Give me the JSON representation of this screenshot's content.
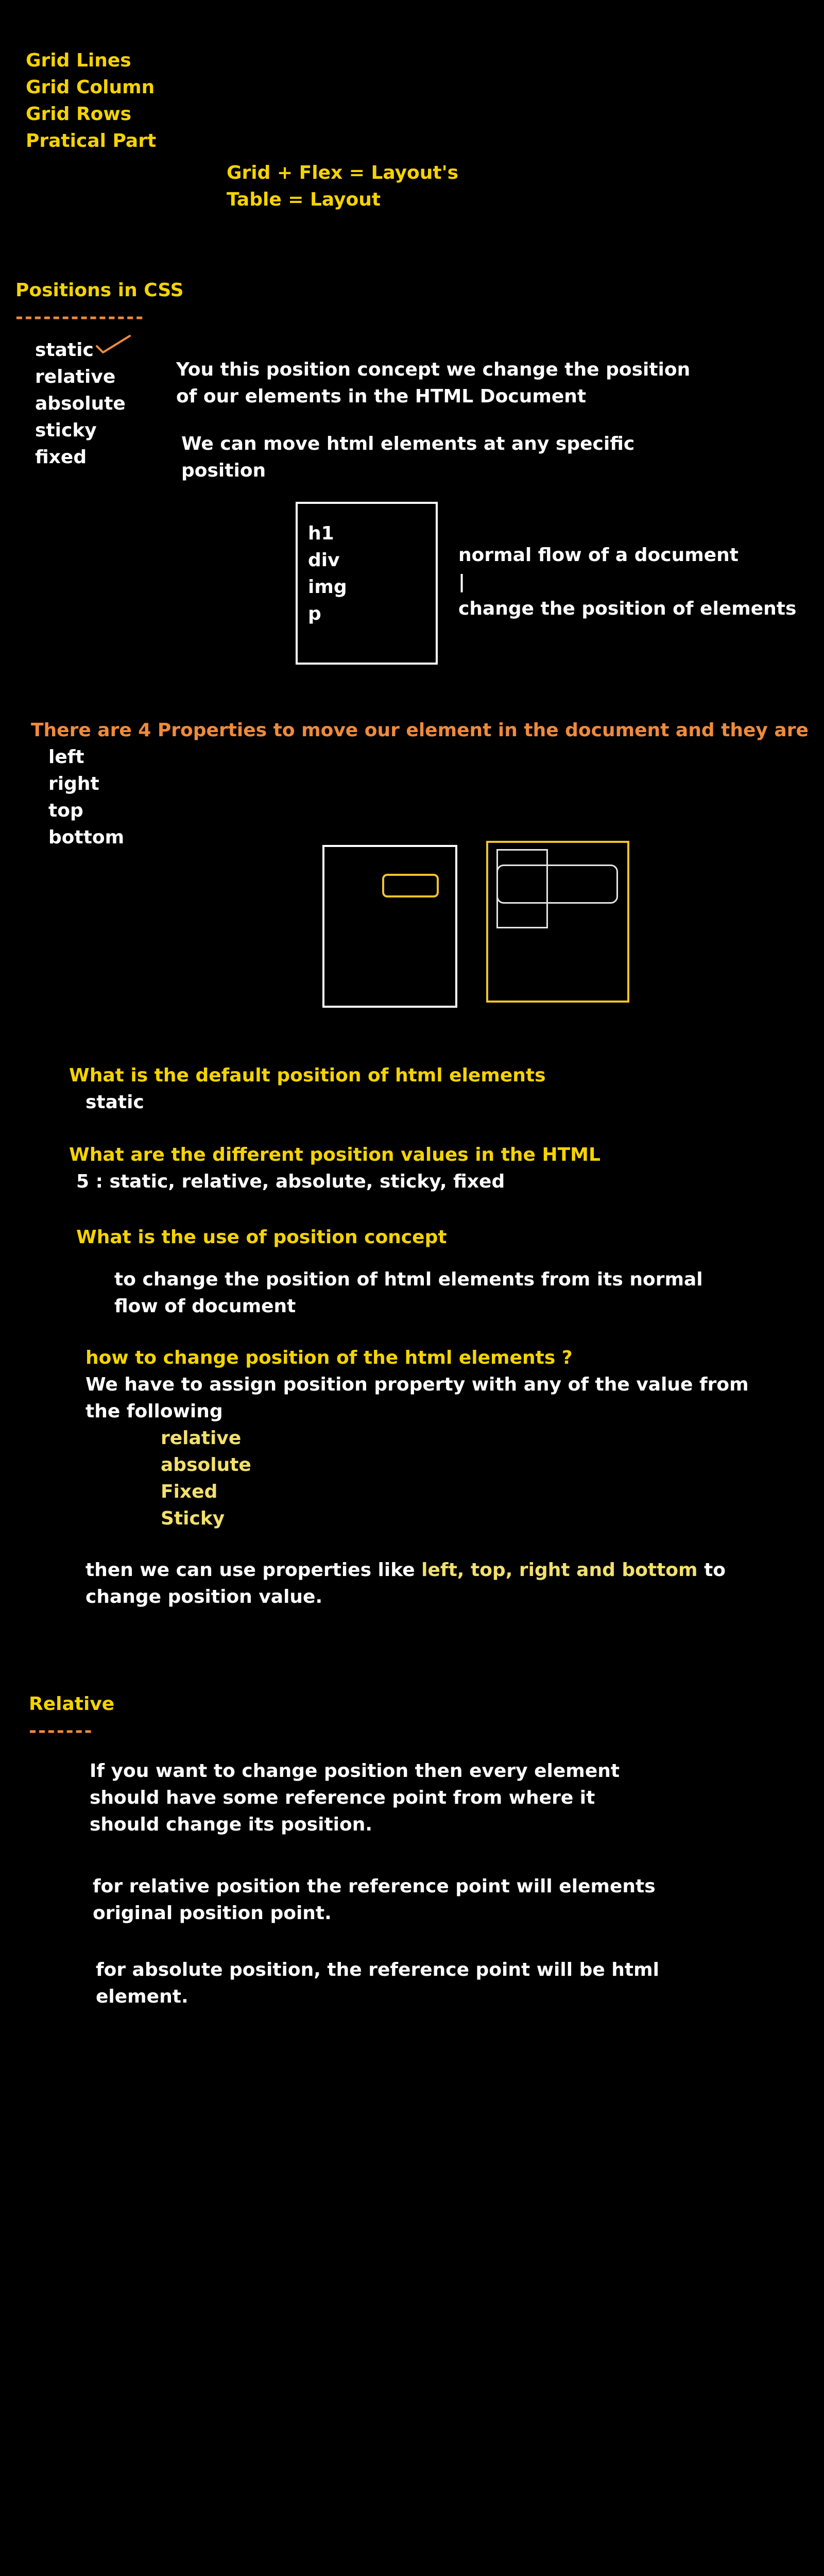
{
  "grid_topics": [
    "Grid Lines",
    "Grid Column",
    "Grid Rows",
    "Pratical Part"
  ],
  "layout_notes": [
    "Grid + Flex = Layout's",
    "Table = Layout"
  ],
  "positions_section": {
    "title": "Positions in CSS",
    "underline": "--------------",
    "values": [
      "static",
      "relative",
      "absolute",
      "sticky",
      "fixed"
    ],
    "desc1": [
      "You this position concept we change the position",
      "of our elements in the HTML Document"
    ],
    "desc2": [
      "We can move html elements at any specific",
      "position"
    ],
    "flow_box_items": [
      "h1",
      "div",
      "img",
      "p"
    ],
    "flow_notes": [
      "normal flow of a document",
      "|",
      "change the position of elements"
    ]
  },
  "properties_section": {
    "heading": "There are 4 Properties to move our element in the document and they are",
    "items": [
      "left",
      "right",
      "top",
      "bottom"
    ]
  },
  "qa": {
    "q1": "What is the default position of html elements",
    "a1": "static",
    "q2": "What are the different position values in the HTML",
    "a2": "5 : static, relative, absolute, sticky, fixed",
    "q3": "What is the use of position concept",
    "a3": [
      "to change the position of html elements from its normal",
      "flow of document"
    ],
    "q4": "how to change position of the html elements ?",
    "a4": [
      "We have to assign position property with any of the value from",
      "the following"
    ],
    "a4_values": [
      "relative",
      "absolute",
      "Fixed",
      "Sticky"
    ],
    "a5_parts": {
      "before": "then we can use properties like ",
      "props": "left, top, right and bottom",
      "after": " to",
      "line2": "change position value."
    }
  },
  "relative_section": {
    "title": "Relative",
    "underline": "-------",
    "p1": [
      "If you want to change position then every element",
      "should have some reference point from where it",
      "should change its position."
    ],
    "p2": [
      "for relative position the reference point will elements",
      "original position point."
    ],
    "p3": [
      "for absolute position, the reference point will be html",
      "element."
    ]
  },
  "colors": {
    "background": "#000000",
    "heading_yellow": "#f5d300",
    "text_white": "#ffffff",
    "orange": "#f08a3a",
    "light_yellow": "#f3e06a",
    "box_yellow": "#f0c32a"
  }
}
